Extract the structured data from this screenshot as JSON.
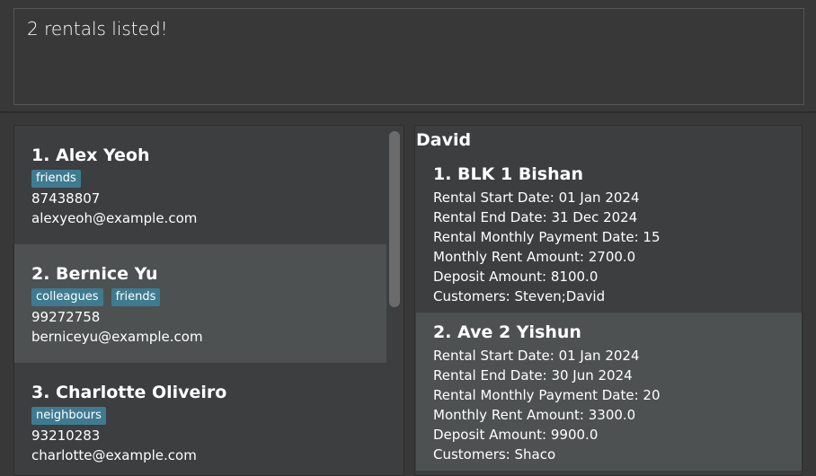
{
  "result": {
    "message": "2 rentals listed!"
  },
  "persons": [
    {
      "title": "1. Alex Yeoh",
      "tags": [
        "friends"
      ],
      "phone": "87438807",
      "email": "alexyeoh@example.com"
    },
    {
      "title": "2. Bernice Yu",
      "tags": [
        "colleagues",
        "friends"
      ],
      "phone": "99272758",
      "email": "berniceyu@example.com"
    },
    {
      "title": "3. Charlotte Oliveiro",
      "tags": [
        "neighbours"
      ],
      "phone": "93210283",
      "email": "charlotte@example.com"
    }
  ],
  "detail": {
    "header": "David",
    "rentals": [
      {
        "title": "1. BLK 1 Bishan",
        "start": "Rental Start Date: 01 Jan 2024",
        "end": "Rental End Date: 31 Dec 2024",
        "payment_date": "Rental Monthly Payment Date: 15",
        "rent": "Monthly Rent Amount: 2700.0",
        "deposit": "Deposit Amount: 8100.0",
        "customers": "Customers: Steven;David"
      },
      {
        "title": "2. Ave 2 Yishun",
        "start": "Rental Start Date: 01 Jan 2024",
        "end": "Rental End Date: 30 Jun 2024",
        "payment_date": "Rental Monthly Payment Date: 20",
        "rent": "Monthly Rent Amount: 3300.0",
        "deposit": "Deposit Amount: 9900.0",
        "customers": "Customers: Shaco"
      }
    ]
  }
}
